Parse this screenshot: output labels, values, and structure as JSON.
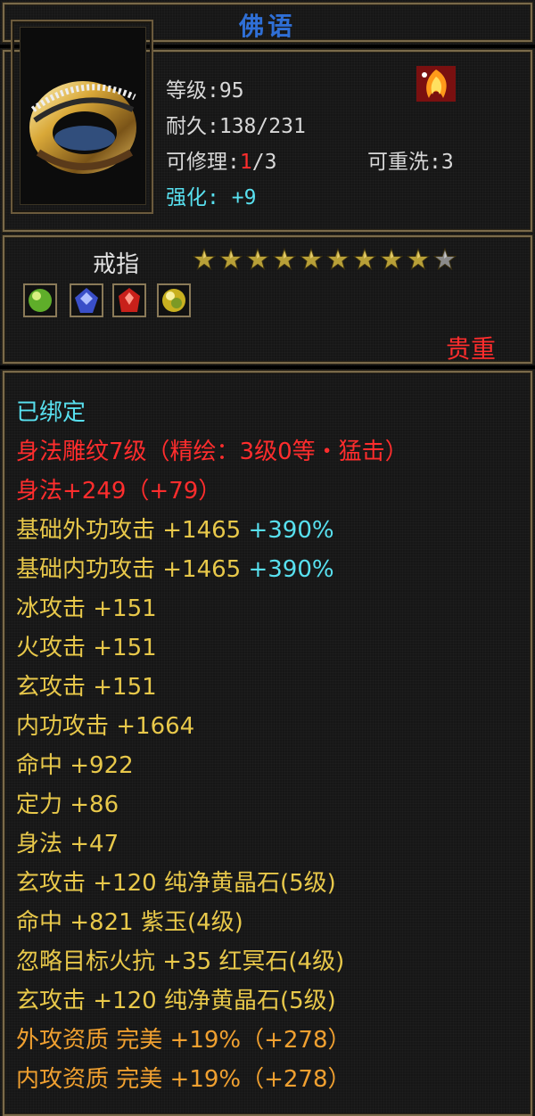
{
  "title": "佛语",
  "item": {
    "level_label": "等级:",
    "level_value": "95",
    "durability_label": "耐久:",
    "durability_value": "138/231",
    "repair_label": "可修理:",
    "repair_used": "1",
    "repair_total": "/3",
    "rewash_label": "可重洗:",
    "rewash_value": "3",
    "enhance_label": "强化:",
    "enhance_value": "+9",
    "type": "戒指",
    "rarity": "贵重",
    "stars_filled": 9,
    "stars_total": 10
  },
  "gems": [
    "green-gem-icon",
    "blue-gem-icon",
    "red-gem-icon",
    "yellow-gem-icon"
  ],
  "attributes": {
    "bound": "已绑定",
    "engrave": "身法雕纹7级（精绘：3级0等・猛击）",
    "agility": "身法+249（+79）",
    "ext_base_a": "基础外功攻击 +1465",
    "ext_base_b": "+390%",
    "int_base_a": "基础内功攻击 +1465",
    "int_base_b": "+390%",
    "ice": "冰攻击 +151",
    "fire": "火攻击 +151",
    "mystic": "玄攻击 +151",
    "inner": "内功攻击 +1664",
    "hit": "命中 +922",
    "focus": "定力 +86",
    "agi2": "身法 +47",
    "gem1": "玄攻击 +120 纯净黄晶石(5级)",
    "gem2": "命中 +821 紫玉(4级)",
    "gem3": "忽略目标火抗 +35 红冥石(4级)",
    "gem4": "玄攻击 +120 纯净黄晶石(5级)",
    "q_ext": "外攻资质 完美 +19%（+278）",
    "q_int": "内攻资质 完美 +19%（+278）"
  },
  "colors": {
    "white": "#e2e2e2",
    "yellow": "#e8c84a",
    "cyan": "#58e0ef",
    "red": "#ff2d2d",
    "orange": "#f0a030",
    "title": "#2f6fd6"
  }
}
